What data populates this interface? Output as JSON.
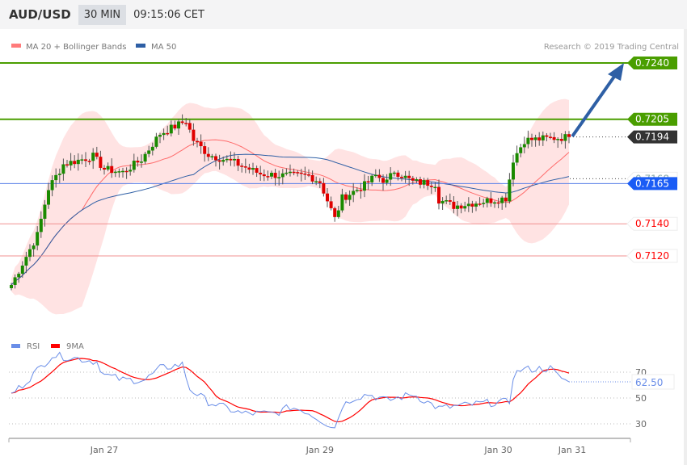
{
  "header": {
    "symbol": "AUD/USD",
    "timeframe": "30 MIN",
    "time": "09:15:06 CET"
  },
  "legend": {
    "ma20": "MA 20 + Bollinger Bands",
    "ma50": "MA 50",
    "copyright": "Research © 2019 Trading Central"
  },
  "colors": {
    "resistance": "#4a9e00",
    "current": "#333333",
    "ma50": "#2e5fa5",
    "pivot": "#1a5cf5",
    "support": "#ff0000",
    "bands": "#ffe3e3",
    "ma20": "#ff6b6b",
    "rsi": "#6a8ee8",
    "ma9": "#ff0000"
  },
  "levels": [
    {
      "label": "0.7240",
      "value": 7240,
      "type": "resistance"
    },
    {
      "label": "0.7205",
      "value": 7205,
      "type": "resistance"
    },
    {
      "label": "0.7194",
      "value": 7194,
      "type": "current"
    },
    {
      "label": "0.7168",
      "value": 7168,
      "type": "ma"
    },
    {
      "label": "0.7165",
      "value": 7165,
      "type": "pivot"
    },
    {
      "label": "0.7140",
      "value": 7140,
      "type": "support"
    },
    {
      "label": "0.7120",
      "value": 7120,
      "type": "support"
    }
  ],
  "chart_data": {
    "type": "candlestick",
    "price_keypoints": [
      [
        0,
        7102
      ],
      [
        7,
        7133
      ],
      [
        10,
        7162
      ],
      [
        14,
        7177
      ],
      [
        22,
        7182
      ],
      [
        25,
        7174
      ],
      [
        30,
        7172
      ],
      [
        35,
        7180
      ],
      [
        40,
        7196
      ],
      [
        47,
        7204
      ],
      [
        49,
        7192
      ],
      [
        53,
        7183
      ],
      [
        60,
        7178
      ],
      [
        67,
        7171
      ],
      [
        73,
        7170
      ],
      [
        80,
        7170
      ],
      [
        83,
        7166
      ],
      [
        87,
        7143
      ],
      [
        89,
        7156
      ],
      [
        95,
        7164
      ],
      [
        98,
        7170
      ],
      [
        101,
        7166
      ],
      [
        103,
        7173
      ],
      [
        108,
        7166
      ],
      [
        114,
        7165
      ],
      [
        115,
        7155
      ],
      [
        119,
        7151
      ],
      [
        127,
        7154
      ],
      [
        133,
        7156
      ],
      [
        135,
        7180
      ],
      [
        138,
        7192
      ],
      [
        150,
        7194
      ]
    ],
    "rsi": {
      "legend": [
        "RSI",
        "9MA"
      ],
      "ticks": [
        "70",
        "50",
        "30"
      ],
      "current": "62.50",
      "keypoints": [
        [
          0,
          53
        ],
        [
          3,
          60
        ],
        [
          10,
          80
        ],
        [
          11,
          83
        ],
        [
          17,
          81
        ],
        [
          23,
          78
        ],
        [
          25,
          68
        ],
        [
          30,
          64
        ],
        [
          36,
          64
        ],
        [
          40,
          73
        ],
        [
          46,
          76
        ],
        [
          48,
          57
        ],
        [
          53,
          47
        ],
        [
          62,
          38
        ],
        [
          71,
          38
        ],
        [
          75,
          43
        ],
        [
          79,
          40
        ],
        [
          85,
          30
        ],
        [
          87,
          27
        ],
        [
          89,
          44
        ],
        [
          92,
          50
        ],
        [
          96,
          53
        ],
        [
          101,
          48
        ],
        [
          108,
          53
        ],
        [
          115,
          42
        ],
        [
          127,
          46
        ],
        [
          134,
          47
        ],
        [
          135,
          67
        ],
        [
          137,
          72
        ],
        [
          145,
          73
        ],
        [
          147,
          67
        ],
        [
          150,
          62.5
        ]
      ]
    },
    "x_ticks": [
      {
        "label": "Jan 27",
        "index": 25
      },
      {
        "label": "Jan 29",
        "index": 83
      },
      {
        "label": "Jan 30",
        "index": 131
      },
      {
        "label": "Jan 31",
        "index": 150
      }
    ]
  }
}
